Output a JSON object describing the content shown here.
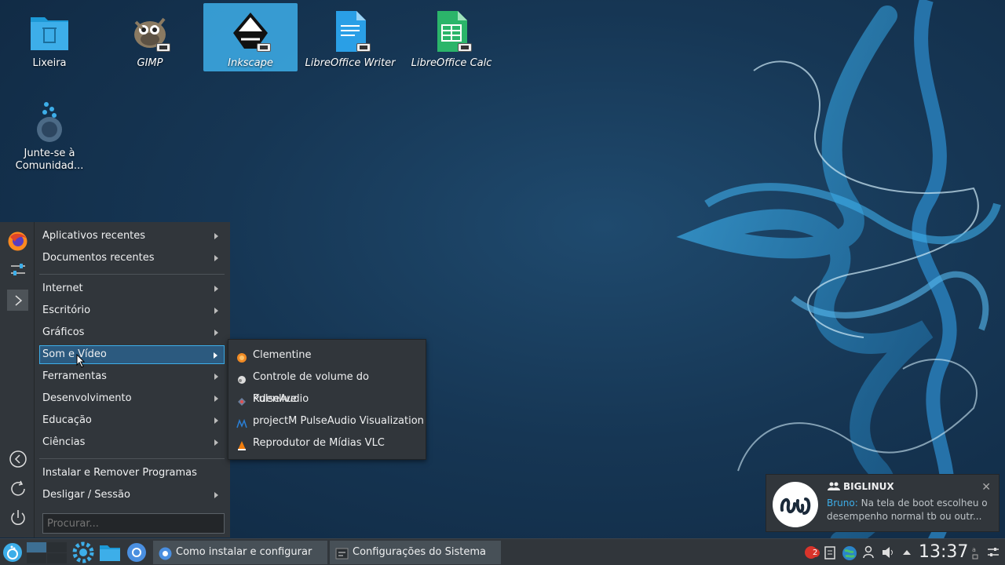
{
  "desktop": {
    "icons": [
      {
        "label": "Lixeira",
        "icon": "trash-icon"
      },
      {
        "label": "GIMP",
        "icon": "gimp-icon"
      },
      {
        "label": "Inkscape",
        "icon": "inkscape-icon",
        "selected": true
      },
      {
        "label": "LibreOffice Writer",
        "icon": "writer-icon"
      },
      {
        "label": "LibreOffice Calc",
        "icon": "calc-icon"
      },
      {
        "label": "Junte-se à Comunidad...",
        "icon": "community-icon"
      }
    ]
  },
  "start_menu": {
    "side_buttons": [
      "firefox-icon",
      "settings-sliders-icon",
      "expand-icon",
      "back-icon",
      "refresh-icon",
      "power-icon"
    ],
    "items": [
      {
        "label": "Aplicativos recentes",
        "has_submenu": true
      },
      {
        "label": "Documentos recentes",
        "has_submenu": true
      },
      {
        "label": "Internet",
        "has_submenu": true
      },
      {
        "label": "Escritório",
        "has_submenu": true
      },
      {
        "label": "Gráficos",
        "has_submenu": true
      },
      {
        "label": "Som e Vídeo",
        "has_submenu": true,
        "active": true
      },
      {
        "label": "Ferramentas",
        "has_submenu": true
      },
      {
        "label": "Desenvolvimento",
        "has_submenu": true
      },
      {
        "label": "Educação",
        "has_submenu": true
      },
      {
        "label": "Ciências",
        "has_submenu": true
      },
      {
        "label": "Instalar e Remover Programas",
        "has_submenu": false
      },
      {
        "label": "Desligar / Sessão",
        "has_submenu": true
      }
    ],
    "search_placeholder": "Procurar..."
  },
  "submenu": {
    "items": [
      {
        "label": "Clementine",
        "icon": "clementine-icon"
      },
      {
        "label": "Controle de volume do PulseAudio",
        "icon": "pulseaudio-icon"
      },
      {
        "label": "Kdenlive",
        "icon": "kdenlive-icon"
      },
      {
        "label": "projectM PulseAudio Visualization",
        "icon": "projectm-icon"
      },
      {
        "label": "Reprodutor de Mídias VLC",
        "icon": "vlc-icon"
      }
    ]
  },
  "notification": {
    "title": "BIGLINUX",
    "sender": "Bruno:",
    "message": "Na tela de boot escolheu o desempenho normal tb ou outr..."
  },
  "taskbar": {
    "tasks": [
      {
        "label": "Como instalar e configurar o...",
        "icon": "chromium-icon"
      },
      {
        "label": "Configurações do Sistema",
        "icon": "system-settings-icon"
      }
    ],
    "badge_count": "2",
    "clock": "13:37"
  },
  "colors": {
    "accent": "#3daee9",
    "panel": "#31363b",
    "active_item": "#2c5a7f"
  }
}
